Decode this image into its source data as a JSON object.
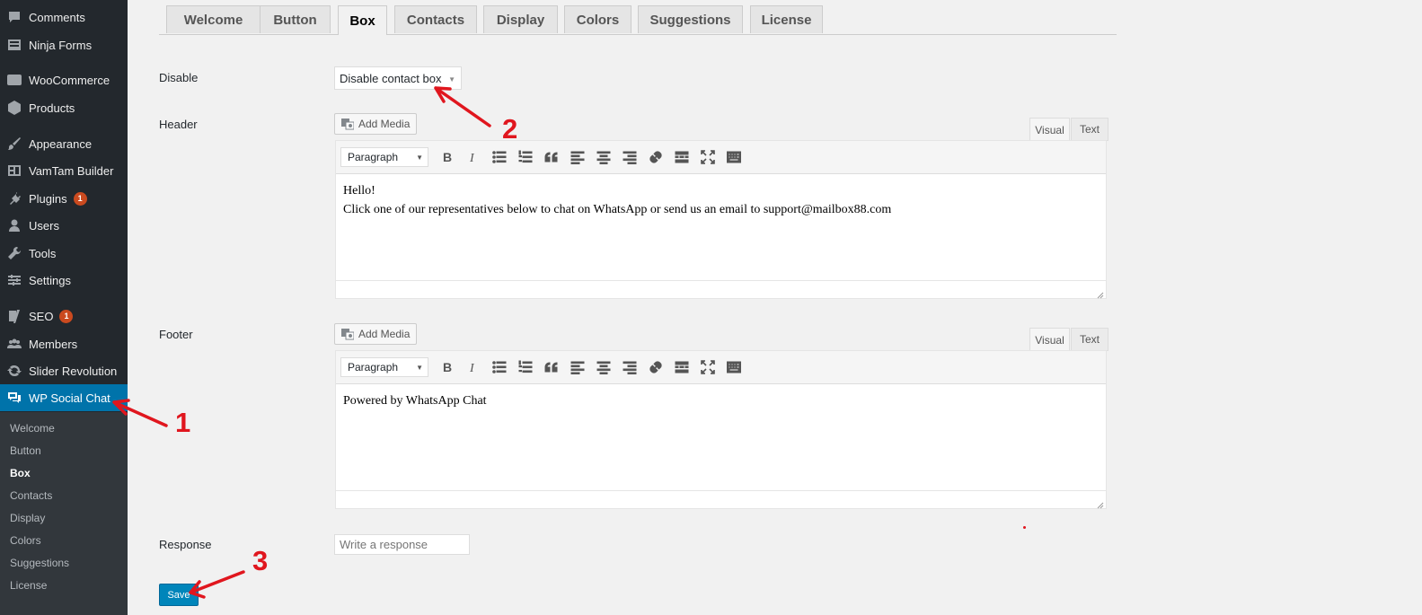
{
  "sidebar": {
    "items": [
      {
        "label": "Comments",
        "icon": "comment-icon"
      },
      {
        "label": "Ninja Forms",
        "icon": "forms-icon"
      },
      {
        "label": "WooCommerce",
        "icon": "woocommerce-icon"
      },
      {
        "label": "Products",
        "icon": "box-icon"
      },
      {
        "label": "Appearance",
        "icon": "brush-icon"
      },
      {
        "label": "VamTam Builder",
        "icon": "builder-icon"
      },
      {
        "label": "Plugins",
        "icon": "plug-icon",
        "badge": "1"
      },
      {
        "label": "Users",
        "icon": "user-icon"
      },
      {
        "label": "Tools",
        "icon": "wrench-icon"
      },
      {
        "label": "Settings",
        "icon": "settings-icon"
      },
      {
        "label": "SEO",
        "icon": "yoast-icon",
        "badge": "1"
      },
      {
        "label": "Members",
        "icon": "members-icon"
      },
      {
        "label": "Slider Revolution",
        "icon": "refresh-icon"
      },
      {
        "label": "WP Social Chat",
        "icon": "chat-icon",
        "active": true
      }
    ],
    "submenu": [
      "Welcome",
      "Button",
      "Box",
      "Contacts",
      "Display",
      "Colors",
      "Suggestions",
      "License"
    ],
    "submenu_current": "Box"
  },
  "tabs": [
    "Welcome",
    "Button",
    "Box",
    "Contacts",
    "Display",
    "Colors",
    "Suggestions",
    "License"
  ],
  "active_tab": "Box",
  "form": {
    "disable_label": "Disable",
    "disable_value": "Disable contact box",
    "header_label": "Header",
    "footer_label": "Footer",
    "response_label": "Response",
    "response_placeholder": "Write a response",
    "save_label": "Save"
  },
  "editor": {
    "add_media": "Add Media",
    "visual_tab": "Visual",
    "text_tab": "Text",
    "format": "Paragraph",
    "toolbar_icons": [
      "bold-icon",
      "italic-icon",
      "bullet-list-icon",
      "numbered-list-icon",
      "blockquote-icon",
      "align-left-icon",
      "align-center-icon",
      "align-right-icon",
      "link-icon",
      "read-more-icon",
      "fullscreen-icon",
      "toolbar-toggle-icon"
    ]
  },
  "header_content": {
    "line1": "Hello!",
    "line2": "Click one of our representatives below to chat on WhatsApp or send us an email to support@mailbox88.com"
  },
  "footer_content": {
    "line1": "Powered by WhatsApp Chat"
  },
  "annotations": {
    "one": "1",
    "two": "2",
    "three": "3"
  },
  "colors": {
    "accent": "#0073aa",
    "sidebar": "#23282d",
    "submenu": "#32373c",
    "annotation": "#e0161e",
    "badge": "#ca4a1f"
  }
}
